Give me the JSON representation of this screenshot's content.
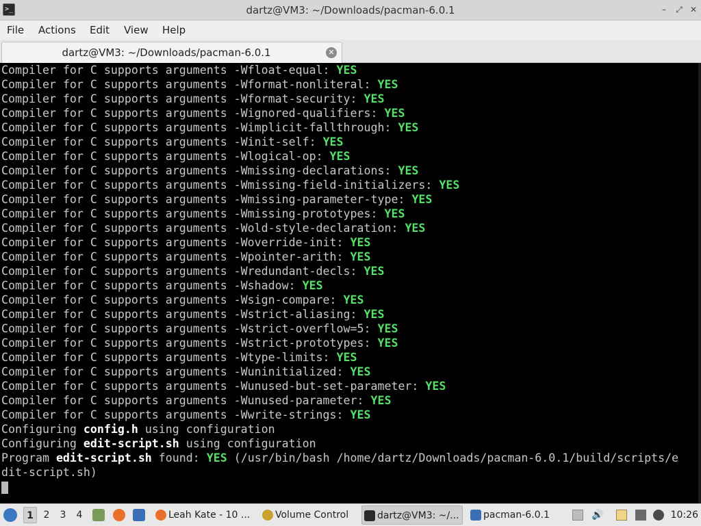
{
  "window": {
    "title": "dartz@VM3: ~/Downloads/pacman-6.0.1",
    "controls": {
      "minimize": "–",
      "maximize": "✕",
      "close": "✕"
    }
  },
  "menubar": {
    "items": [
      "File",
      "Actions",
      "Edit",
      "View",
      "Help"
    ]
  },
  "tab": {
    "label": "dartz@VM3: ~/Downloads/pacman-6.0.1",
    "close": "✕"
  },
  "terminal": {
    "compiler_prefix": "Compiler for C supports arguments ",
    "compiler_checks": [
      {
        "flag": "-Wfloat-equal",
        "result": "YES"
      },
      {
        "flag": "-Wformat-nonliteral",
        "result": "YES"
      },
      {
        "flag": "-Wformat-security",
        "result": "YES"
      },
      {
        "flag": "-Wignored-qualifiers",
        "result": "YES"
      },
      {
        "flag": "-Wimplicit-fallthrough",
        "result": "YES"
      },
      {
        "flag": "-Winit-self",
        "result": "YES"
      },
      {
        "flag": "-Wlogical-op",
        "result": "YES"
      },
      {
        "flag": "-Wmissing-declarations",
        "result": "YES"
      },
      {
        "flag": "-Wmissing-field-initializers",
        "result": "YES"
      },
      {
        "flag": "-Wmissing-parameter-type",
        "result": "YES"
      },
      {
        "flag": "-Wmissing-prototypes",
        "result": "YES"
      },
      {
        "flag": "-Wold-style-declaration",
        "result": "YES"
      },
      {
        "flag": "-Woverride-init",
        "result": "YES"
      },
      {
        "flag": "-Wpointer-arith",
        "result": "YES"
      },
      {
        "flag": "-Wredundant-decls",
        "result": "YES"
      },
      {
        "flag": "-Wshadow",
        "result": "YES"
      },
      {
        "flag": "-Wsign-compare",
        "result": "YES"
      },
      {
        "flag": "-Wstrict-aliasing",
        "result": "YES"
      },
      {
        "flag": "-Wstrict-overflow=5",
        "result": "YES"
      },
      {
        "flag": "-Wstrict-prototypes",
        "result": "YES"
      },
      {
        "flag": "-Wtype-limits",
        "result": "YES"
      },
      {
        "flag": "-Wuninitialized",
        "result": "YES"
      },
      {
        "flag": "-Wunused-but-set-parameter",
        "result": "YES"
      },
      {
        "flag": "-Wunused-parameter",
        "result": "YES"
      },
      {
        "flag": "-Wwrite-strings",
        "result": "YES"
      }
    ],
    "configuring": [
      {
        "prefix": "Configuring ",
        "file": "config.h",
        "suffix": " using configuration"
      },
      {
        "prefix": "Configuring ",
        "file": "edit-script.sh",
        "suffix": " using configuration"
      }
    ],
    "program_line": {
      "prefix": "Program ",
      "name": "edit-script.sh",
      "middle": " found: ",
      "result": "YES",
      "path": " (/usr/bin/bash /home/dartz/Downloads/pacman-6.0.1/build/scripts/e",
      "continuation": "dit-script.sh)"
    }
  },
  "taskbar": {
    "workspaces": [
      "1",
      "2",
      "3",
      "4"
    ],
    "active_workspace": "1",
    "tasks": [
      {
        "label": "Leah Kate - 10 ...",
        "icon": "firefox-icon"
      },
      {
        "label": "Volume Control",
        "icon": "volume-control-icon"
      },
      {
        "label": "dartz@VM3: ~/...",
        "icon": "terminal-icon"
      },
      {
        "label": "pacman-6.0.1",
        "icon": "folder-icon"
      }
    ],
    "clock": "10:26"
  },
  "colors": {
    "yes_green": "#55e06a",
    "terminal_bg": "#000000",
    "terminal_fg": "#c8c8c8"
  }
}
